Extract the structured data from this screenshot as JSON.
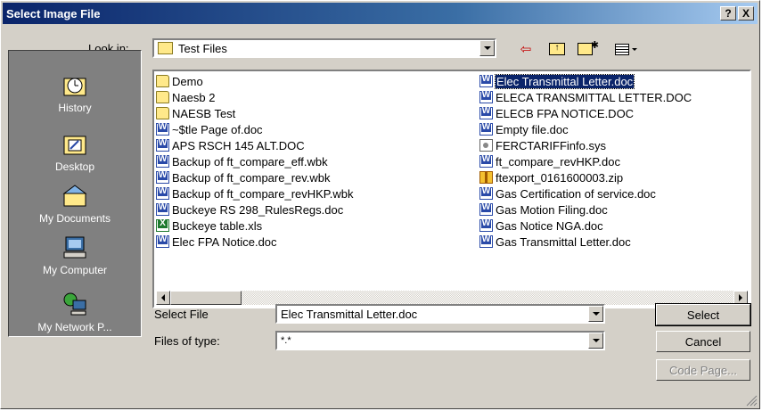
{
  "window": {
    "title": "Select Image File",
    "help_btn": "?",
    "close_btn": "X"
  },
  "lookin": {
    "label": "Look in:",
    "value": "Test Files"
  },
  "places": [
    {
      "label": "History",
      "icon": "history-icon"
    },
    {
      "label": "Desktop",
      "icon": "desktop-icon"
    },
    {
      "label": "My Documents",
      "icon": "my-documents-icon"
    },
    {
      "label": "My Computer",
      "icon": "my-computer-icon"
    },
    {
      "label": "My Network P...",
      "icon": "my-network-places-icon"
    }
  ],
  "files_col1": [
    {
      "name": "Demo",
      "type": "folder"
    },
    {
      "name": "Naesb 2",
      "type": "folder"
    },
    {
      "name": "NAESB Test",
      "type": "folder"
    },
    {
      "name": "~$tle Page of.doc",
      "type": "doc"
    },
    {
      "name": "APS RSCH 145 ALT.DOC",
      "type": "doc"
    },
    {
      "name": "Backup of ft_compare_eff.wbk",
      "type": "doc"
    },
    {
      "name": "Backup of ft_compare_rev.wbk",
      "type": "doc"
    },
    {
      "name": "Backup of ft_compare_revHKP.wbk",
      "type": "doc"
    },
    {
      "name": "Buckeye RS 298_RulesRegs.doc",
      "type": "doc"
    },
    {
      "name": "Buckeye table.xls",
      "type": "xls"
    },
    {
      "name": "Elec FPA Notice.doc",
      "type": "doc"
    }
  ],
  "files_col2": [
    {
      "name": "Elec Transmittal Letter.doc",
      "type": "doc",
      "selected": true
    },
    {
      "name": "ELECA TRANSMITTAL LETTER.DOC",
      "type": "doc"
    },
    {
      "name": "ELECB FPA NOTICE.DOC",
      "type": "doc"
    },
    {
      "name": "Empty file.doc",
      "type": "doc"
    },
    {
      "name": "FERCTARIFFinfo.sys",
      "type": "sys"
    },
    {
      "name": "ft_compare_revHKP.doc",
      "type": "doc"
    },
    {
      "name": "ftexport_0161600003.zip",
      "type": "zip"
    },
    {
      "name": "Gas Certification of service.doc",
      "type": "doc"
    },
    {
      "name": "Gas Motion Filing.doc",
      "type": "doc"
    },
    {
      "name": "Gas Notice NGA.doc",
      "type": "doc"
    },
    {
      "name": "Gas Transmittal Letter.doc",
      "type": "doc"
    }
  ],
  "select_file": {
    "label": "Select File",
    "value": "Elec Transmittal Letter.doc"
  },
  "file_type": {
    "label": "Files of type:",
    "value": "*.*"
  },
  "buttons": {
    "select": "Select",
    "cancel": "Cancel",
    "code_page": "Code Page..."
  },
  "colors": {
    "title_bar": "#0a246a",
    "selection": "#0a246a",
    "face": "#d4d0c8"
  }
}
